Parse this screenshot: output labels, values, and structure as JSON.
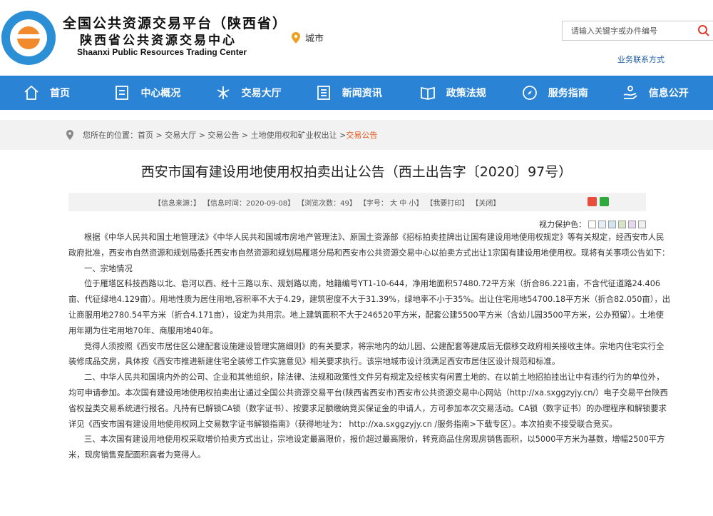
{
  "header": {
    "title_line1": "全国公共资源交易平台（陕西省）",
    "title_line2": "陕西省公共资源交易中心",
    "title_en": "Shaanxi Public Resources Trading Center",
    "city_label": "城市",
    "search_placeholder": "请输入关键字或办件编号",
    "biz_link": "业务联系方式"
  },
  "nav": [
    {
      "label": "首页",
      "icon": "home-icon"
    },
    {
      "label": "中心概况",
      "icon": "document-icon"
    },
    {
      "label": "交易大厅",
      "icon": "hall-icon"
    },
    {
      "label": "新闻资讯",
      "icon": "news-icon"
    },
    {
      "label": "政策法规",
      "icon": "book-icon"
    },
    {
      "label": "服务指南",
      "icon": "compass-icon"
    },
    {
      "label": "信息公开",
      "icon": "hand-icon"
    }
  ],
  "breadcrumb": {
    "prefix": "您所在的位置：",
    "path": "首页 > 交易大厅 > 交易公告 > 土地使用权和矿业权出让 > ",
    "current": "交易公告"
  },
  "article_title": "西安市国有建设用地使用权拍卖出让公告（西土出告字〔2020〕97号）",
  "info": {
    "source": "【信息来源：】",
    "time": "【信息时间：2020-09-08】",
    "views": "【浏览次数：49】",
    "font": "【字号： 大 中 小】",
    "print": "【我要打印】",
    "close": "【关闭】"
  },
  "eye_label": "视力保护色：",
  "eye_colors": [
    "#ffffff",
    "#e6eef6",
    "#cfe6ee",
    "#d8e6c8",
    "#e6d8ee",
    "#f0f0f0"
  ],
  "paragraphs": [
    "根据《中华人民共和国土地管理法》《中华人民共和国城市房地产管理法》、原国土资源部《招标拍卖挂牌出让国有建设用地使用权规定》等有关规定，经西安市人民政府批准，西安市自然资源和规划局委托西安市自然资源和规划局雁塔分局和西安市公共资源交易中心以拍卖方式出让1宗国有建设用地使用权。现将有关事项公告如下：",
    "一、宗地情况",
    "位于雁塔区科技西路以北、皂河以西、经十三路以东、规划路以南，地籍编号YT1-10-644，净用地面积57480.72平方米（折合86.221亩，不含代征道路24.406亩、代征绿地4.129亩）。用地性质为居住用地,容积率不大于4.29，建筑密度不大于31.39%，绿地率不小于35%。出让住宅用地54700.18平方米（折合82.050亩），出让商服用地2780.54平方米（折合4.171亩），设定为共用宗。地上建筑面积不大于246520平方米，配套公建5500平方米（含幼儿园3500平方米，公办预留）。土地使用年期为住宅用地70年、商服用地40年。",
    "竞得人须按照《西安市居住区公建配套设施建设管理实施细则》的有关要求，将宗地内的幼儿园、公建配套等建成后无偿移交政府相关接收主体。宗地内住宅实行全装修成品交房，具体按《西安市推进新建住宅全装修工作实施意见》相关要求执行。该宗地城市设计须满足西安市居住区设计规范和标准。",
    "二、中华人民共和国境内外的公司、企业和其他组织，除法律、法规和政策性文件另有规定及经核实有闲置土地的、在以前土地招拍挂出让中有违约行为的单位外，均可申请参加。本次国有建设用地使用权拍卖出让通过全国公共资源交易平台(陕西省西安市)西安市公共资源交易中心网站（http://xa.sxggzyjy.cn/）电子交易平台陕西省权益类交易系统进行报名。凡持有已解锁CA锁（数字证书）、按要求足额缴纳竞买保证金的申请人，方可参加本次交易活动。CA锁（数字证书）的办理程序和解锁要求详见《西安市国有建设用地使用权网上交易数字证书解锁指南》（获得地址为： http://xa.sxggzyjy.cn /服务指南>下载专区）。本次拍卖不接受联合竞买。",
    "三、本次国有建设用地使用权采取增价拍卖方式出让，宗地设定最高限价，报价超过最高限价，转竞商品住房现房销售面积，以5000平方米为基数，增幅2500平方米，现房销售竞配面积高者为竞得人。"
  ]
}
